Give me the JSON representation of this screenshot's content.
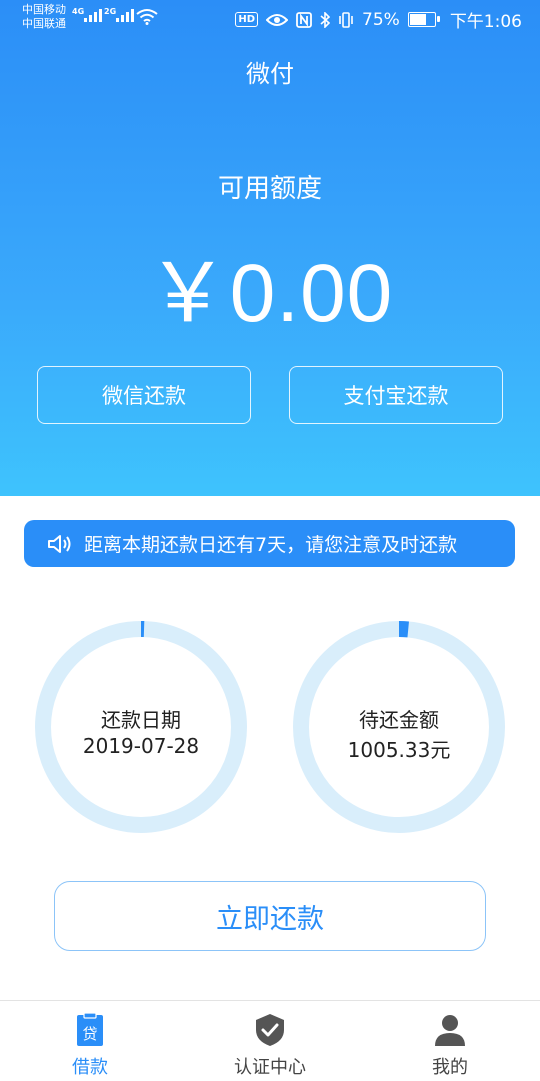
{
  "status_bar": {
    "carrier_1": "中国移动",
    "carrier_2": "中国联通",
    "net_1": "4G",
    "net_2": "2G",
    "hd": "HD",
    "battery": "75%",
    "battery_level": 0.75,
    "time": "下午1:06"
  },
  "header": {
    "title": "微付",
    "available_label": "可用额度",
    "available_amount": "￥0.00"
  },
  "actions": {
    "wechat_repay": "微信还款",
    "alipay_repay": "支付宝还款"
  },
  "notice": {
    "text": "距离本期还款日还有7天，请您注意及时还款"
  },
  "rings": {
    "due_date": {
      "label": "还款日期",
      "value": "2019-07-28",
      "progress": 0.005
    },
    "amount_due": {
      "label": "待还金额",
      "value": "1005.33元",
      "progress": 0.015
    }
  },
  "repay_button": "立即还款",
  "bottom_nav": {
    "items": [
      {
        "label": "借款",
        "icon": "loan-icon",
        "active": true,
        "icon_glyph": "贷"
      },
      {
        "label": "认证中心",
        "icon": "shield-check-icon",
        "active": false
      },
      {
        "label": "我的",
        "icon": "user-icon",
        "active": false
      }
    ]
  },
  "colors": {
    "primary": "#2a8ef8",
    "ring_track": "#d9eefb",
    "hero_top": "#2b8ef7",
    "hero_bottom": "#3ec3fd"
  }
}
